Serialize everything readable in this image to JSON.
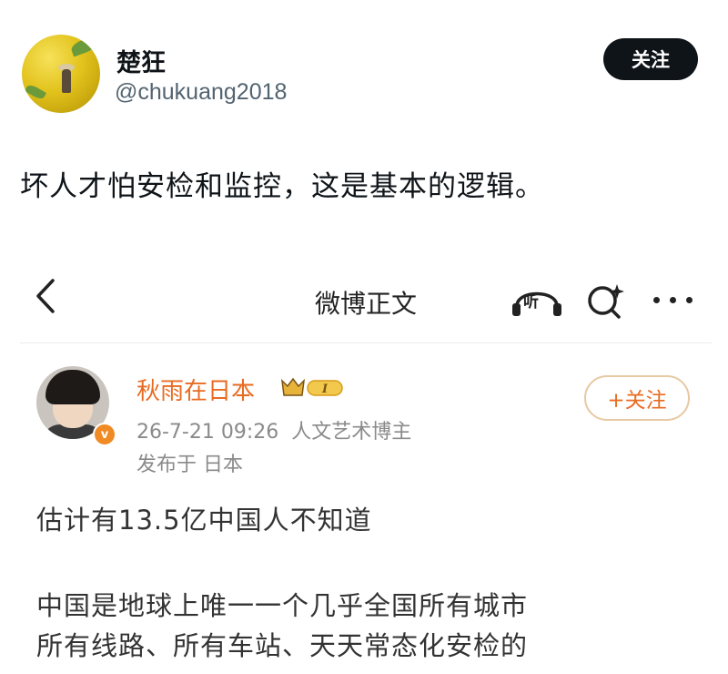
{
  "tweet": {
    "author_name": "楚狂",
    "author_handle": "@chukuang2018",
    "follow_label": "关注",
    "text": "坏人才怕安检和监控，这是基本的逻辑。"
  },
  "embedded": {
    "header": {
      "back_icon": "chevron-left-icon",
      "title": "微博正文",
      "listen_label": "听",
      "search_icon": "ai-search-icon",
      "more_icon": "more-dots-icon"
    },
    "post": {
      "user_name": "秋雨在日本",
      "vip_badge_text": "I",
      "date_time": "26-7-21 09:26",
      "source": "人文艺术博主",
      "location": "发布于 日本",
      "follow_label": "+关注",
      "content_lines": [
        "估计有13.5亿中国人不知道",
        "中国是地球上唯一一个几乎全国所有城市",
        "所有线路、所有车站、天天常态化安检的"
      ]
    }
  },
  "colors": {
    "weibo_orange": "#e86b22",
    "follow_border": "#e7c9a3",
    "twitter_dark": "#0f1419",
    "handle_gray": "#536471"
  }
}
